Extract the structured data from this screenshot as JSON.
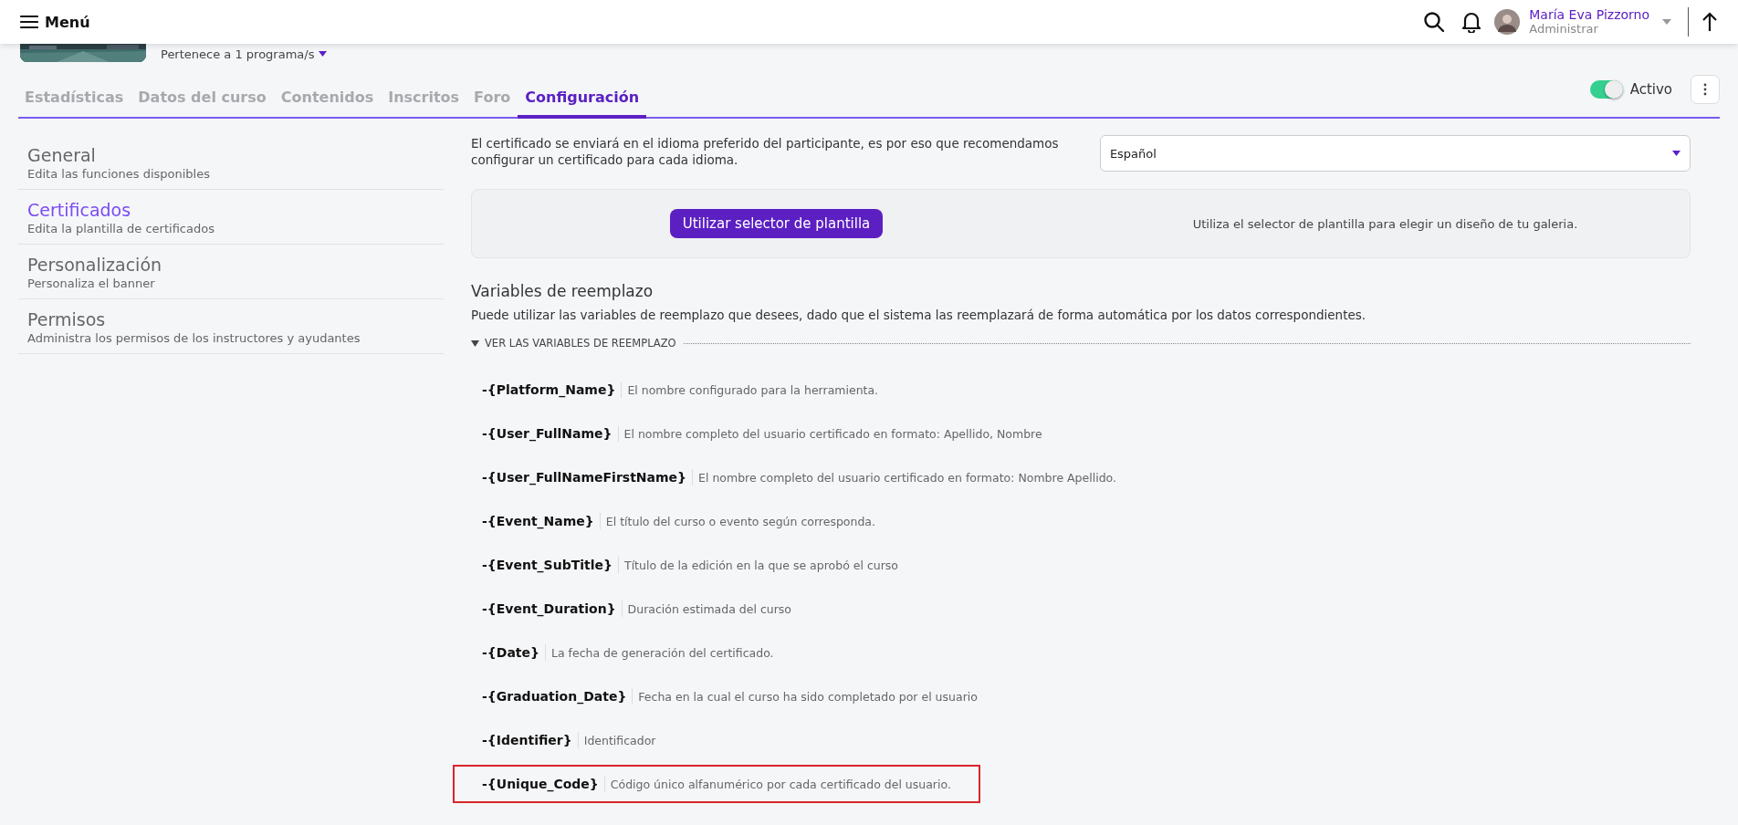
{
  "topbar": {
    "menu_label": "Menú",
    "user_name": "María Eva Pizzorno",
    "user_role": "Administrar"
  },
  "course": {
    "program_link": "Pertenece a 1 programa/s"
  },
  "tabs": [
    {
      "label": "Estadísticas",
      "selected": false
    },
    {
      "label": "Datos del curso",
      "selected": false
    },
    {
      "label": "Contenidos",
      "selected": false
    },
    {
      "label": "Inscritos",
      "selected": false
    },
    {
      "label": "Foro",
      "selected": false
    },
    {
      "label": "Configuración",
      "selected": true
    }
  ],
  "status_toggle": {
    "label": "Activo",
    "on": true
  },
  "sidebar": {
    "items": [
      {
        "title": "General",
        "subtitle": "Edita las funciones disponibles",
        "selected": false
      },
      {
        "title": "Certificados",
        "subtitle": "Edita la plantilla de certificados",
        "selected": true
      },
      {
        "title": "Personalización",
        "subtitle": "Personaliza el banner",
        "selected": false
      },
      {
        "title": "Permisos",
        "subtitle": "Administra los permisos de los instructores y ayudantes",
        "selected": false
      }
    ]
  },
  "language_note": "El certificado se enviará en el idioma preferido del participante, es por eso que recomendamos configurar un certificado para cada idioma.",
  "language_select": {
    "value": "Español"
  },
  "template_panel": {
    "button": "Utilizar selector de plantilla",
    "hint": "Utiliza el selector de plantilla para elegir un diseño de tu galeria."
  },
  "variables": {
    "title": "Variables de reemplazo",
    "description": "Puede utilizar las variables de reemplazo que desees, dado que el sistema las reemplazará de forma automática por los datos correspondientes.",
    "toggle_label": "VER LAS VARIABLES DE REEMPLAZO",
    "expanded": true,
    "items": [
      {
        "name": "-{Platform_Name}",
        "description": "El nombre configurado para la herramienta.",
        "highlighted": false
      },
      {
        "name": "-{User_FullName}",
        "description": "El nombre completo del usuario certificado en formato: Apellido, Nombre",
        "highlighted": false
      },
      {
        "name": "-{User_FullNameFirstName}",
        "description": "El nombre completo del usuario certificado en formato: Nombre Apellido.",
        "highlighted": false
      },
      {
        "name": "-{Event_Name}",
        "description": "El título del curso o evento según corresponda.",
        "highlighted": false
      },
      {
        "name": "-{Event_SubTitle}",
        "description": "Título de la edición en la que se aprobó el curso",
        "highlighted": false
      },
      {
        "name": "-{Event_Duration}",
        "description": "Duración estimada del curso",
        "highlighted": false
      },
      {
        "name": "-{Date}",
        "description": "La fecha de generación del certificado.",
        "highlighted": false
      },
      {
        "name": "-{Graduation_Date}",
        "description": "Fecha en la cual el curso ha sido completado por el usuario",
        "highlighted": false
      },
      {
        "name": "-{Identifier}",
        "description": "Identificador",
        "highlighted": false
      },
      {
        "name": "-{Unique_Code}",
        "description": "Código único alfanumérico por cada certificado del usuario.",
        "highlighted": true
      }
    ]
  }
}
